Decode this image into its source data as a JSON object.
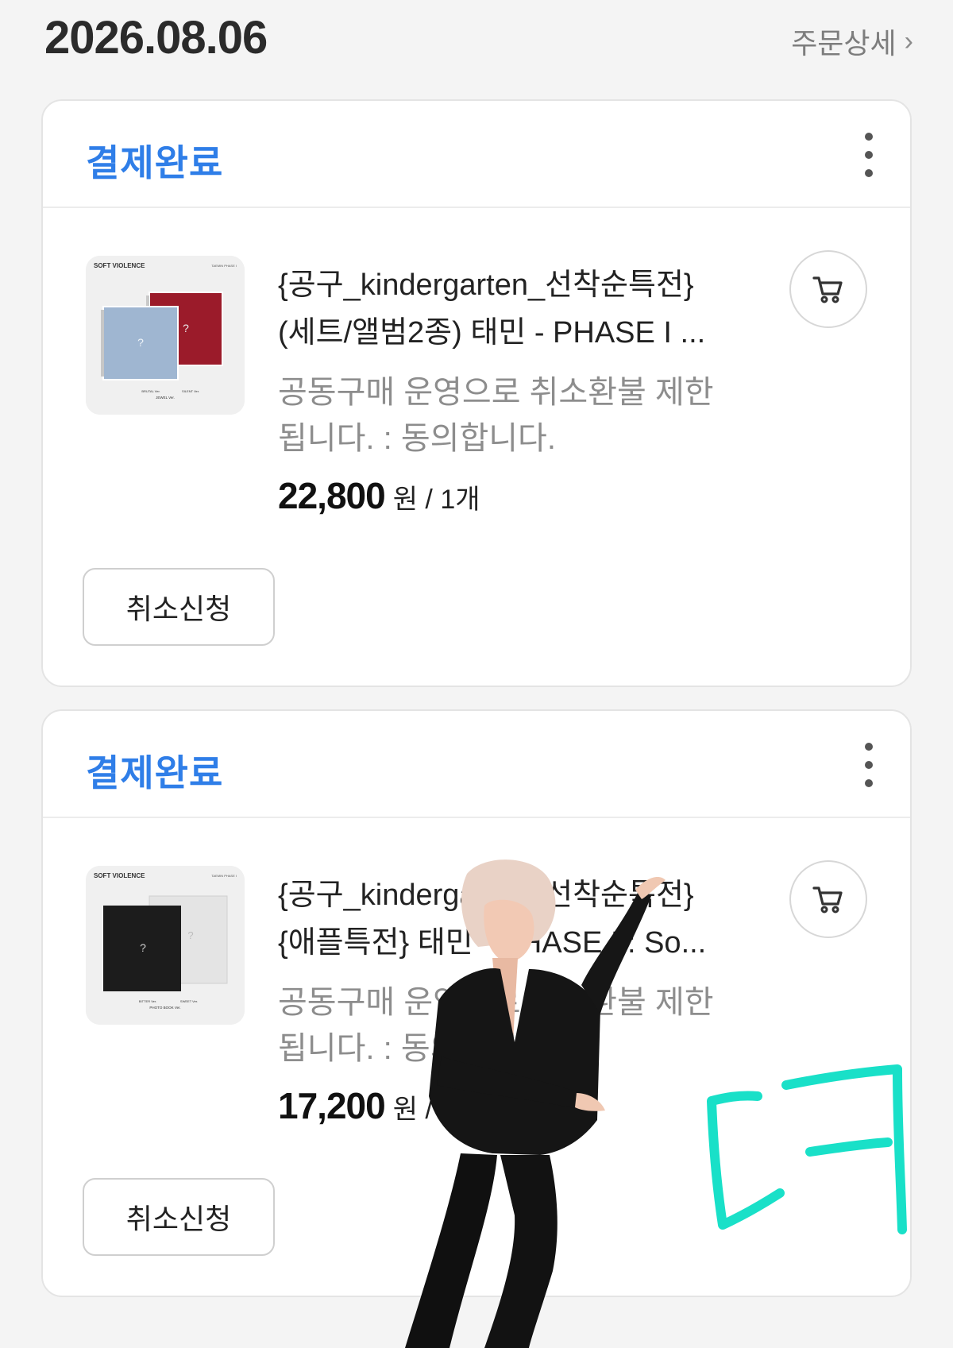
{
  "header": {
    "date": "2026.08.06",
    "detail_link": "주문상세",
    "detail_chevron": "›"
  },
  "orders": [
    {
      "status": "결제완료",
      "title_line1": "{공구_kindergarten_선착순특전}",
      "title_line2": "(세트/앨범2종) 태민 - PHASE I ...",
      "option_line1": "공동구매 운영으로 취소환불 제한",
      "option_line2": "됩니다. : 동의합니다.",
      "price": "22,800",
      "unit": "원 / 1개",
      "cancel_label": "취소신청",
      "thumb": {
        "brand": "SOFT VIOLENCE",
        "badge": "TAEMIN PHASE I",
        "mark": "?",
        "caption_left": "BRUTAL Ver.",
        "caption_right": "SILENT Ver.",
        "caption_bottom": "JEWEL Ver."
      }
    },
    {
      "status": "결제완료",
      "title_line1": "{공구_kindergarten_선착순특전}",
      "title_line2": "{애플특전} 태민 - PHASE I : So...",
      "option_line1": "공동구매 운영으로 취소환불 제한",
      "option_line2": "됩니다. : 동의합니다.",
      "price": "17,200",
      "unit": "원 / 1개",
      "cancel_label": "취소신청",
      "thumb": {
        "brand": "SOFT VIOLENCE",
        "badge": "TAEMIN PHASE I",
        "mark": "?",
        "caption_left": "BITTER Ver.",
        "caption_right": "SWEET Ver.",
        "caption_bottom": "PHOTO BOOK Ver."
      }
    }
  ],
  "icons": {
    "cart": "cart-icon",
    "more": "kebab-menu-icon",
    "chevron": "chevron-right-icon"
  },
  "colors": {
    "status_blue": "#2f7ee8",
    "doodle_teal": "#19e0c8",
    "album_red": "#9b1b2a",
    "album_blue": "#9fb6d1",
    "album_black": "#1c1c1c"
  }
}
